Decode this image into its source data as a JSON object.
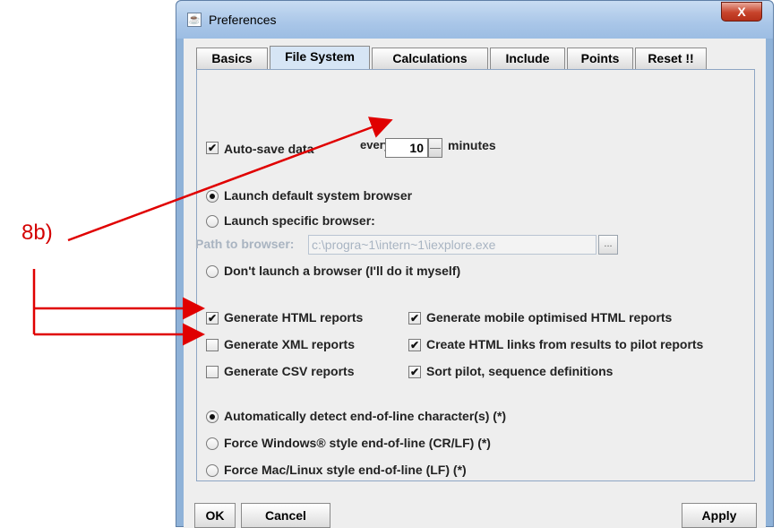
{
  "window": {
    "title": "Preferences",
    "title_icon": "java-icon",
    "close_label": "X"
  },
  "tabs": [
    {
      "label": "Basics",
      "active": false
    },
    {
      "label": "File System",
      "active": true
    },
    {
      "label": "Calculations",
      "active": false
    },
    {
      "label": "Include",
      "active": false
    },
    {
      "label": "Points",
      "active": false
    },
    {
      "label": "Reset !!",
      "active": false
    }
  ],
  "autosave": {
    "label": "Auto-save data",
    "checked": true,
    "every_label": "every",
    "minutes_value": "10",
    "minutes_label": "minutes"
  },
  "browser": {
    "options": [
      {
        "label": "Launch default system browser",
        "selected": true
      },
      {
        "label": "Launch specific browser:",
        "selected": false
      },
      {
        "label": "Don't launch a browser (I'll do it myself)",
        "selected": false
      }
    ],
    "path_label": "Path to browser:",
    "path_value": "c:\\progra~1\\intern~1\\iexplore.exe",
    "browse_label": "..."
  },
  "reports": {
    "generate_html": {
      "label": "Generate HTML reports",
      "checked": true
    },
    "generate_xml": {
      "label": "Generate XML reports",
      "checked": false
    },
    "generate_csv": {
      "label": "Generate CSV reports",
      "checked": false
    },
    "mobile_html": {
      "label": "Generate mobile optimised HTML reports",
      "checked": true
    },
    "html_links": {
      "label": "Create HTML links from results to pilot reports",
      "checked": true
    },
    "sort_pilot": {
      "label": "Sort pilot, sequence definitions",
      "checked": true
    }
  },
  "end_of_line": {
    "options": [
      {
        "label": "Automatically detect end-of-line character(s) (*)",
        "selected": true
      },
      {
        "label": "Force Windows® style end-of-line (CR/LF) (*)",
        "selected": false
      },
      {
        "label": "Force Mac/Linux style end-of-line (LF) (*)",
        "selected": false
      }
    ]
  },
  "buttons": {
    "ok": "OK",
    "cancel": "Cancel",
    "apply": "Apply"
  },
  "annotation": {
    "label": "8b)",
    "color": "#e00000"
  }
}
